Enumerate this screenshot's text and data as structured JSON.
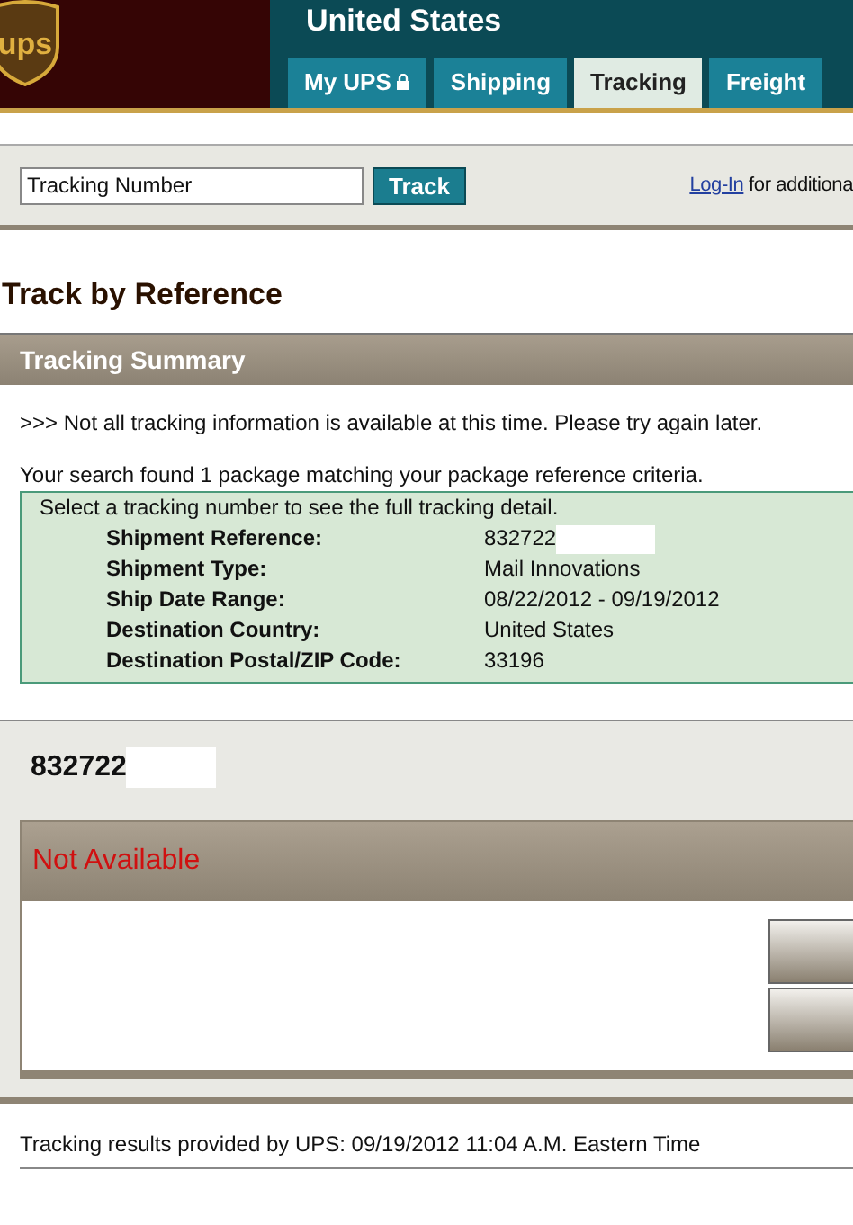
{
  "header": {
    "logo": "ups",
    "region": "United States",
    "tabs": [
      {
        "label": "My UPS",
        "locked": true,
        "selected": false
      },
      {
        "label": "Shipping",
        "locked": false,
        "selected": false
      },
      {
        "label": "Tracking",
        "locked": false,
        "selected": true
      },
      {
        "label": "Freight",
        "locked": false,
        "selected": false
      }
    ]
  },
  "search": {
    "value": "Tracking Number",
    "button": "Track",
    "login_link": "Log-In",
    "login_text": "for additiona"
  },
  "page_title": "Track by Reference",
  "summary": {
    "title": "Tracking Summary",
    "notice": ">>> Not all tracking information is available at this time. Please try again later.",
    "result": "Your search found 1 package matching your package reference criteria.",
    "hint": "Select a tracking number to see the full tracking detail.",
    "details": [
      {
        "label": "Shipment Reference:",
        "value": "832722",
        "redacted": true
      },
      {
        "label": "Shipment Type:",
        "value": "Mail Innovations",
        "redacted": false
      },
      {
        "label": "Ship Date Range:",
        "value": "08/22/2012 - 09/19/2012",
        "redacted": false
      },
      {
        "label": "Destination Country:",
        "value": "United States",
        "redacted": false
      },
      {
        "label": "Destination Postal/ZIP Code:",
        "value": "33196",
        "redacted": false
      }
    ]
  },
  "package": {
    "number": "832722",
    "redacted": true,
    "status": "Not Available"
  },
  "footer": "Tracking results provided by UPS:  09/19/2012 11:04 A.M.  Eastern Time"
}
